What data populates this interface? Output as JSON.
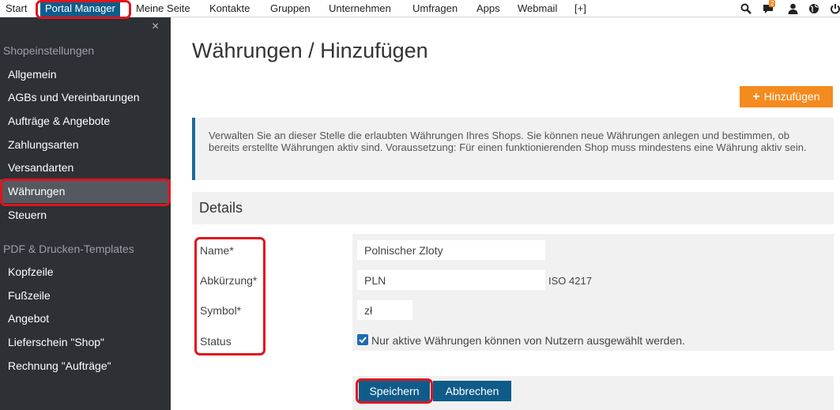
{
  "topnav": {
    "items": [
      {
        "label": "Start"
      },
      {
        "label": "Portal Manager"
      },
      {
        "label": "Meine Seite"
      },
      {
        "label": "Kontakte"
      },
      {
        "label": "Gruppen"
      },
      {
        "label": "Unternehmen"
      },
      {
        "label": "Umfragen"
      },
      {
        "label": "Apps"
      },
      {
        "label": "Webmail"
      },
      {
        "label": "[+]"
      }
    ],
    "active_item": "Portal Manager",
    "notification_count": "2",
    "icons": [
      "search-icon",
      "chat-icon",
      "user-icon",
      "globe-icon",
      "power-icon"
    ]
  },
  "sidebar": {
    "close_glyph": "×",
    "section1": "Shopeinstellungen",
    "items1": [
      {
        "label": "Allgemein"
      },
      {
        "label": "AGBs und Vereinbarungen"
      },
      {
        "label": "Aufträge & Angebote"
      },
      {
        "label": "Zahlungsarten"
      },
      {
        "label": "Versandarten"
      },
      {
        "label": "Währungen"
      },
      {
        "label": "Steuern"
      }
    ],
    "active_item": "Währungen",
    "section2": "PDF & Drucken-Templates",
    "items2": [
      {
        "label": "Kopfzeile"
      },
      {
        "label": "Fußzeile"
      },
      {
        "label": "Angebot"
      },
      {
        "label": "Lieferschein \"Shop\""
      },
      {
        "label": "Rechnung \"Aufträge\""
      }
    ]
  },
  "main": {
    "title": "Währungen / Hinzufügen",
    "add_button": "Hinzufügen",
    "info_text": "Verwalten Sie an dieser Stelle die erlaubten Währungen Ihres Shops. Sie können neue Währungen anlegen und bestimmen, ob bereits erstellte Währungen aktiv sind. Voraussetzung: Für einen funktionierenden Shop muss mindestens eine Währung aktiv sein.",
    "details_heading": "Details",
    "form": {
      "name_label": "Name*",
      "name_value": "Polnischer Zloty",
      "abbr_label": "Abkürzung*",
      "abbr_value": "PLN",
      "abbr_note": "ISO 4217",
      "symbol_label": "Symbol*",
      "symbol_value": "zł",
      "status_label": "Status",
      "status_checked": true,
      "status_text": "Nur aktive Währungen können von Nutzern ausgewählt werden."
    },
    "save_button": "Speichern",
    "cancel_button": "Abbrechen"
  },
  "colors": {
    "nav_active": "#0f5c8a",
    "sidebar_bg": "#2d3035",
    "sidebar_active": "#55595f",
    "accent_orange": "#f58a1e",
    "primary_blue": "#0f5c8a",
    "highlight_red": "#e0141e"
  }
}
